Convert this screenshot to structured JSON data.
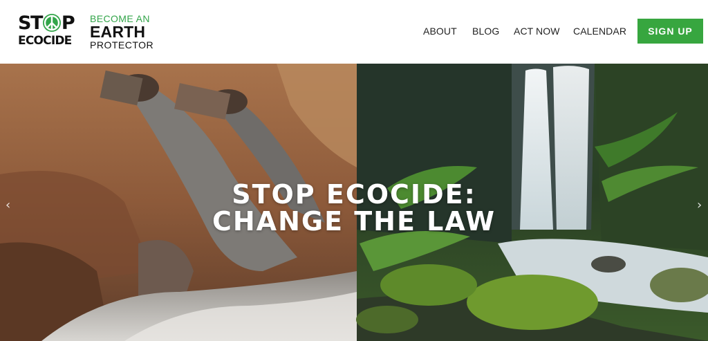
{
  "logo": {
    "main_top": "ST",
    "main_top_after": "P",
    "main_bottom": "ECOCIDE",
    "tag_line1": "BECOME AN",
    "tag_line2": "EARTH",
    "tag_line3": "PROTECTOR",
    "icon": "peace-sign-icon",
    "accent": "#33a54a"
  },
  "nav": {
    "items": [
      "ABOUT",
      "BLOG",
      "ACT NOW",
      "CALENDAR"
    ],
    "cta": "SIGN UP",
    "cta_color": "#37a63f"
  },
  "hero": {
    "title_line1": "STOP ECOCIDE:",
    "title_line2": "CHANGE THE LAW",
    "prev_icon": "chevron-left-icon",
    "next_icon": "chevron-right-icon",
    "prev_glyph": "‹",
    "next_glyph": "›"
  }
}
